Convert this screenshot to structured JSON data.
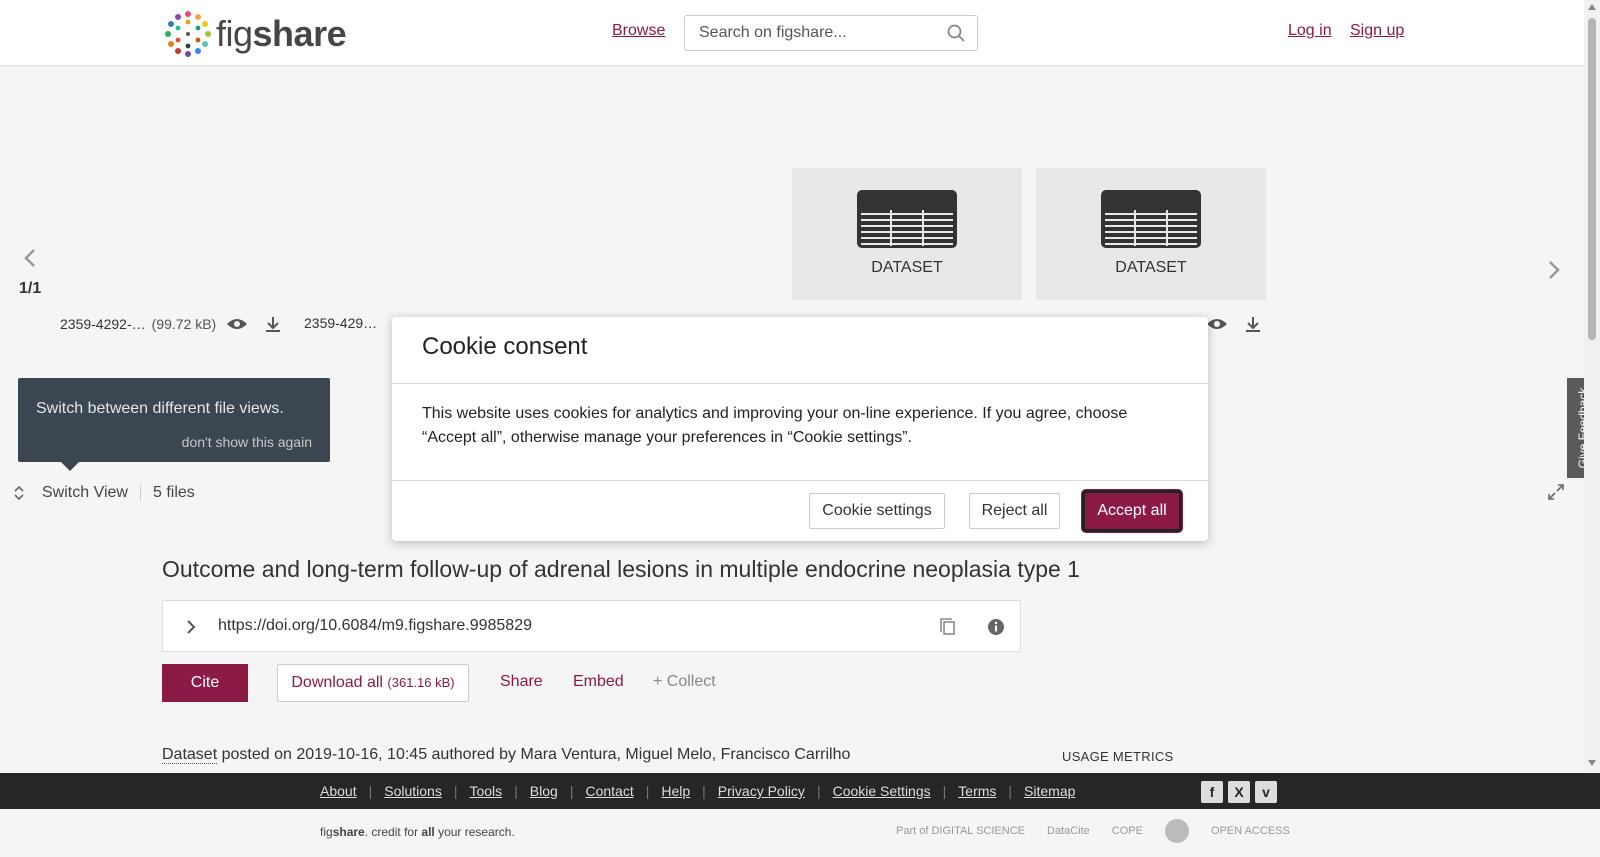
{
  "header": {
    "brand_light": "fig",
    "brand_bold": "share",
    "browse": "Browse",
    "search_placeholder": "Search on figshare...",
    "login": "Log in",
    "signup": "Sign up"
  },
  "viewer": {
    "pager": "1/1",
    "tiles": [
      {
        "label": "DATASET"
      },
      {
        "label": "DATASET"
      }
    ],
    "files": [
      {
        "name": "2359-4292-…",
        "size": "(99.72 kB)"
      },
      {
        "name": "2359-429…",
        "size": ""
      }
    ],
    "tooltip": {
      "text": "Switch between different file views.",
      "dismiss": "don't show this again"
    },
    "switch_view": "Switch View",
    "files_count": "5 files"
  },
  "feedback": "Give Feedback",
  "article": {
    "title": "Outcome and long-term follow-up of adrenal lesions in multiple endocrine neoplasia type 1",
    "doi": "https://doi.org/10.6084/m9.figshare.9985829",
    "cite": "Cite",
    "download_label": "Download all ",
    "download_size": "(361.16 kB)",
    "share": "Share",
    "embed": "Embed",
    "collect": "+ Collect",
    "item_type": "Dataset",
    "posted_text": " posted on 2019-10-16, 10:45 authored by Mara Ventura, Miguel Melo, Francisco Carrilho",
    "usage_metrics": "USAGE METRICS"
  },
  "footer": {
    "links": [
      "About",
      "Solutions",
      "Tools",
      "Blog",
      "Contact",
      "Help",
      "Privacy Policy",
      "Cookie Settings",
      "Terms",
      "Sitemap"
    ],
    "social": [
      "f",
      "X",
      "v"
    ],
    "tagline_fig": "fig",
    "tagline_share": "share",
    "tagline_mid": ". credit for ",
    "tagline_all": "all",
    "tagline_end": " your research.",
    "partners": [
      "Part of DIGITAL SCIENCE",
      "DataCite",
      "COPE",
      "OPEN ACCESS"
    ]
  },
  "cookie_modal": {
    "title": "Cookie consent",
    "body": "This website uses cookies for analytics and improving your on-line experience. If you agree, choose “Accept all”, otherwise manage your preferences in “Cookie settings”.",
    "settings": "Cookie settings",
    "reject": "Reject all",
    "accept": "Accept all"
  },
  "colors": {
    "brand": "#8c1a47",
    "footer_dark": "#262626",
    "viewer_bg": "#f5f5f5"
  },
  "icons": [
    "search-icon",
    "chevron-left-icon",
    "chevron-right-icon",
    "dataset-icon",
    "eye-icon",
    "download-icon",
    "switch-view-icon",
    "fullscreen-icon",
    "chevron-right-icon",
    "copy-icon",
    "info-icon"
  ]
}
